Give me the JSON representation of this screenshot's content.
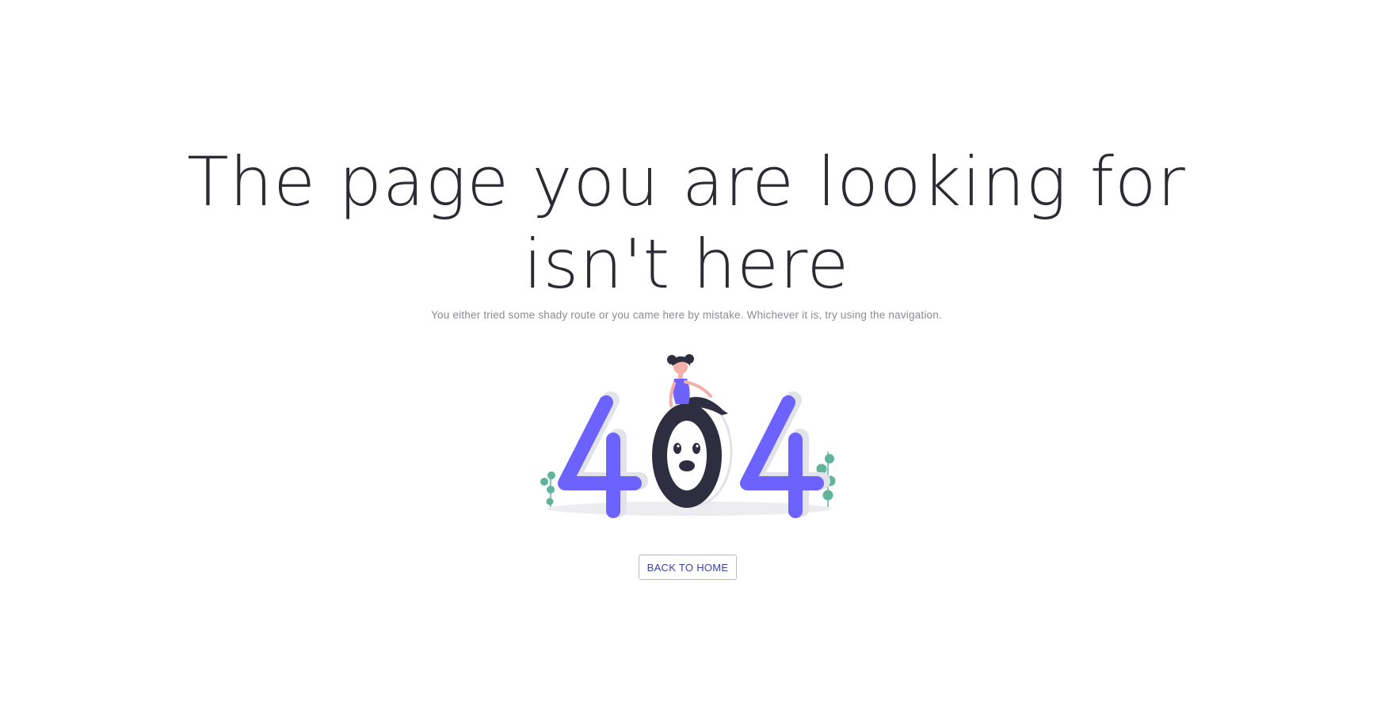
{
  "error_page": {
    "heading_line1": "The page you are looking for",
    "heading_line2": "isn't here",
    "message": "You either tried some shady route or you came here by mistake. Whichever it is, try using the navigation.",
    "illustration_text": "404",
    "back_button_label": "BACK TO HOME"
  },
  "colors": {
    "accent": "#6c63ff",
    "dark": "#2f2e41",
    "plant": "#5fb49a",
    "button_text": "#3f3fa8"
  },
  "icons": {
    "illustration": "404-woman-sitting-illustration"
  }
}
